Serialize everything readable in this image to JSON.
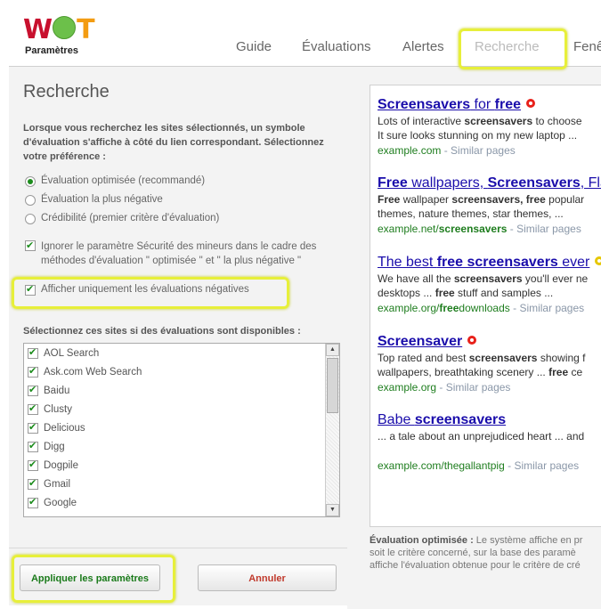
{
  "logo": {
    "w": "W",
    "t": "T",
    "subtitle": "Paramètres"
  },
  "nav": [
    "Guide",
    "Évaluations",
    "Alertes",
    "Recherche",
    "Fenê"
  ],
  "search": {
    "title": "Recherche",
    "description": "Lorsque vous recherchez les sites sélectionnés, un symbole d'évaluation s'affiche à côté du lien correspondant. Sélectionnez votre préférence :",
    "radios": [
      "Évaluation optimisée (recommandé)",
      "Évaluation la plus négative",
      "Crédibilité (premier critère d'évaluation)"
    ],
    "selected_radio": 0,
    "ignore_minors": "Ignorer le paramètre Sécurité des mineurs dans le cadre des méthodes d'évaluation \" optimisée \" et \" la plus négative \"",
    "ignore_minors_checked": true,
    "only_negative": "Afficher uniquement les évaluations négatives",
    "only_negative_checked": true,
    "sites_label": "Sélectionnez ces sites si des évaluations sont disponibles :",
    "sites": [
      "AOL Search",
      "Ask.com Web Search",
      "Baidu",
      "Clusty",
      "Delicious",
      "Digg",
      "Dogpile",
      "Gmail",
      "Google"
    ]
  },
  "buttons": {
    "apply": "Appliquer les paramètres",
    "cancel": "Annuler"
  },
  "colors": {
    "apply": "#1a7a1a",
    "cancel": "#c0392b",
    "highlight": "#e7ef3a",
    "link": "#1a0dab",
    "url": "#1e7d1e"
  },
  "preview": {
    "similar": "Similar pages",
    "results": [
      {
        "title_parts": [
          [
            "Screensavers",
            true
          ],
          [
            " for ",
            false
          ],
          [
            "free",
            true
          ]
        ],
        "icon": "red-ring-icon",
        "snippet": [
          [
            [
              "Lots of interactive ",
              false
            ],
            [
              "screensavers",
              true
            ],
            [
              " to choose",
              false
            ]
          ],
          [
            [
              "It sure looks stunning on my new laptop ...",
              false
            ]
          ]
        ],
        "url": [
          [
            "example.com",
            false
          ]
        ]
      },
      {
        "title_parts": [
          [
            "Free",
            true
          ],
          [
            " wallpapers, ",
            false
          ],
          [
            "Screensavers",
            true
          ],
          [
            ", Fla",
            false
          ]
        ],
        "icon": null,
        "snippet": [
          [
            [
              "Free",
              true
            ],
            [
              " wallpaper ",
              false
            ],
            [
              "screensavers, free",
              true
            ],
            [
              " popular",
              false
            ]
          ],
          [
            [
              "themes, nature themes, star themes, ...",
              false
            ]
          ]
        ],
        "url": [
          [
            "example.net/",
            false
          ],
          [
            "screensavers",
            true
          ]
        ]
      },
      {
        "title_parts": [
          [
            "The best ",
            false
          ],
          [
            "free screensavers",
            true
          ],
          [
            " ever",
            false
          ]
        ],
        "icon": "yellow-ring-icon",
        "snippet": [
          [
            [
              "We have all the ",
              false
            ],
            [
              "screensavers",
              true
            ],
            [
              " you'll ever ne",
              false
            ]
          ],
          [
            [
              "desktops ... ",
              false
            ],
            [
              "free",
              true
            ],
            [
              " stuff and samples ...",
              false
            ]
          ]
        ],
        "url": [
          [
            "example.org/",
            false
          ],
          [
            "free",
            true
          ],
          [
            "downloads",
            false
          ]
        ]
      },
      {
        "title_parts": [
          [
            "Screensaver",
            true
          ]
        ],
        "icon": "red-ring-icon",
        "snippet": [
          [
            [
              "Top rated and best ",
              false
            ],
            [
              "screensavers",
              true
            ],
            [
              " showing f",
              false
            ]
          ],
          [
            [
              "wallpapers, breathtaking scenery ... ",
              false
            ],
            [
              "free",
              true
            ],
            [
              " ce",
              false
            ]
          ]
        ],
        "url": [
          [
            "example.org",
            false
          ]
        ]
      },
      {
        "title_parts": [
          [
            "Babe ",
            false
          ],
          [
            "screensavers",
            true
          ]
        ],
        "icon": null,
        "snippet": [
          [
            [
              "... a tale about an unprejudiced heart ... and",
              false
            ]
          ],
          [
            [
              "",
              false
            ]
          ]
        ],
        "url": [
          [
            "example.com/thegallantpig",
            false
          ]
        ]
      }
    ],
    "note_bold": "Évaluation optimisée :",
    "note_lines": [
      " Le système affiche en pr",
      "soit le critère concerné, sur la base des paramè",
      "affiche l'évaluation obtenue pour le critère de cré"
    ]
  }
}
